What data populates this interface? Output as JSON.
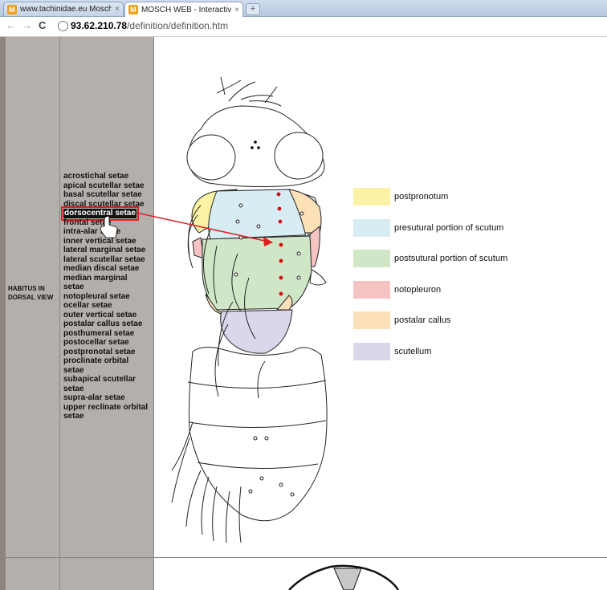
{
  "tabs": [
    {
      "title": "www.tachinidae.eu Mosch...",
      "close": "×",
      "favicon": "M",
      "active": false
    },
    {
      "title": "MOSCH WEB - Interactive ...",
      "close": "×",
      "favicon": "M",
      "active": true
    }
  ],
  "newtab": "+",
  "toolbar": {
    "back": "←",
    "forward": "→",
    "reload": "C",
    "url_host": "93.62.210.78",
    "url_path": "/definition/definition.htm"
  },
  "sidebar": {
    "heading_line1": "HABITUS IN",
    "heading_line2": "DORSAL VIEW"
  },
  "terms": [
    "acrostichal setae",
    "apical scutellar setae",
    "basal scutellar setae",
    "discal scutellar setae",
    "dorsocentral setae",
    "frontal setae",
    "intra-alar setae",
    "inner vertical setae",
    "lateral marginal setae",
    "lateral scutellar setae",
    "median discal setae",
    "median marginal",
    "setae",
    "notopleural setae",
    "ocellar setae",
    "outer vertical setae",
    "postalar callus setae",
    "posthumeral setae",
    "postocellar setae",
    "postpronotal setae",
    "proclinate orbital",
    "setae",
    "subapical scutellar",
    "setae",
    "supra-alar setae",
    "upper reclinate orbital",
    "setae"
  ],
  "selected_term": "dorsocentral setae",
  "legend": [
    {
      "label": "postpronotum",
      "color": "#fbf2a6"
    },
    {
      "label": "presutural portion of scutum",
      "color": "#d8ecf3"
    },
    {
      "label": "postsutural portion of scutum",
      "color": "#cfe7c7"
    },
    {
      "label": "notopleuron",
      "color": "#f6c3c3"
    },
    {
      "label": "postalar callus",
      "color": "#fbe0b8"
    },
    {
      "label": "scutellum",
      "color": "#dcd6ea"
    }
  ],
  "colors": {
    "arrow": "#e02020",
    "highlight": "#e02020",
    "setae_dots": "#d01010"
  }
}
